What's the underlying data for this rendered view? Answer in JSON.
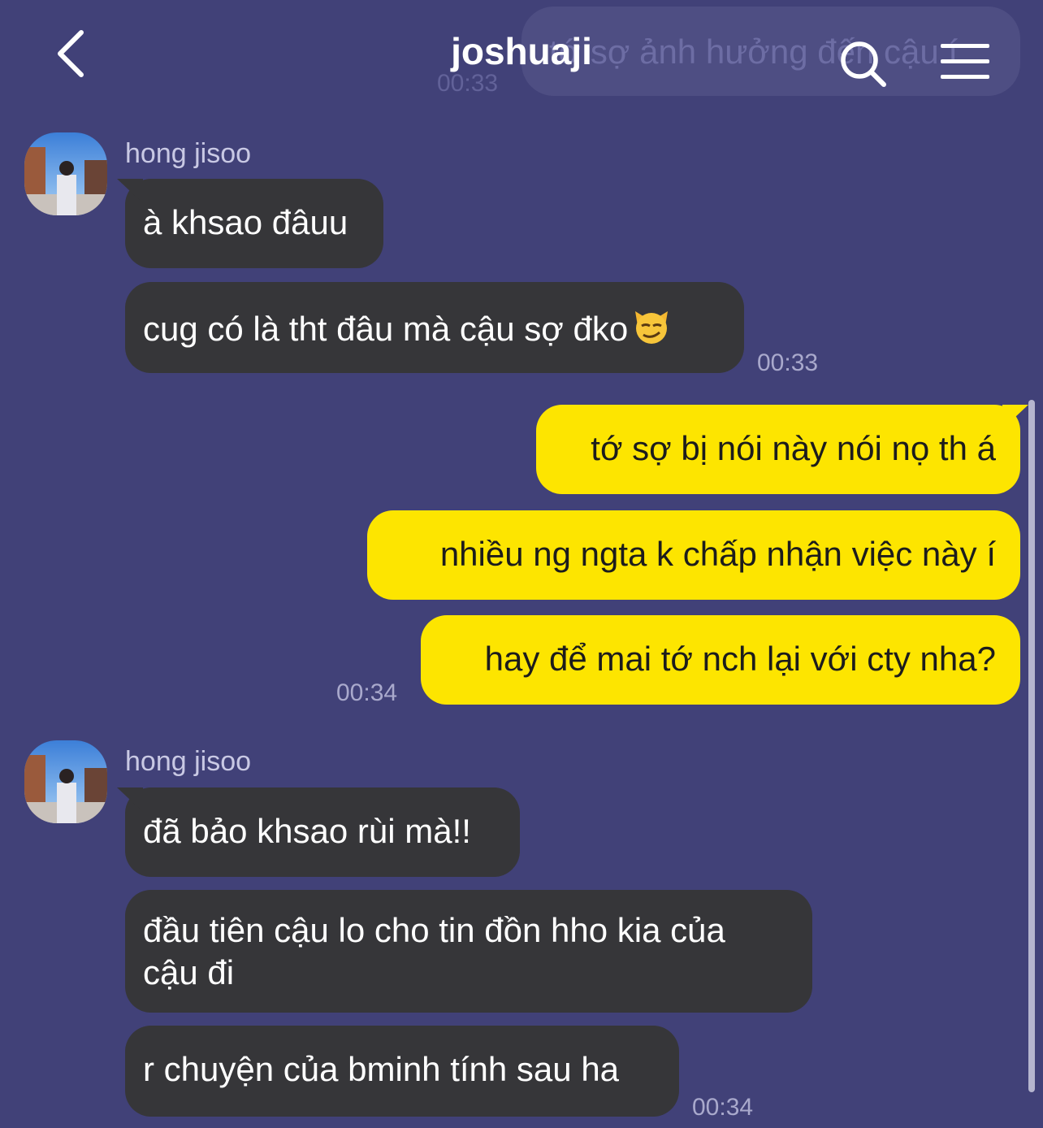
{
  "header": {
    "title": "joshuaji",
    "back_icon": "chevron-left-icon",
    "search_icon": "search-icon",
    "menu_icon": "hamburger-menu-icon"
  },
  "ghost": {
    "text": "tớ sợ ảnh hưởng đến cậu í",
    "time": "00:33"
  },
  "colors": {
    "background": "#414178",
    "incoming_bubble": "#363639",
    "outgoing_bubble": "#fde500"
  },
  "groups": [
    {
      "sender": "hong jisoo",
      "messages": [
        "à khsao đâuu",
        "cug có là tht đâu mà cậu sợ đko"
      ],
      "emoji": "smirking-cat-emoji",
      "time": "00:33"
    },
    {
      "sender": "me",
      "messages": [
        "tớ sợ bị nói này nói nọ th á",
        "nhiều ng ngta k chấp nhận việc này í",
        "hay để mai tớ nch lại với cty nha?"
      ],
      "time": "00:34"
    },
    {
      "sender": "hong jisoo",
      "messages": [
        "đã bảo khsao rùi mà!!",
        "đầu tiên cậu lo cho tin đồn hho kia của",
        "cậu đi",
        "r chuyện của bminh tính sau ha"
      ],
      "time": "00:34"
    }
  ]
}
